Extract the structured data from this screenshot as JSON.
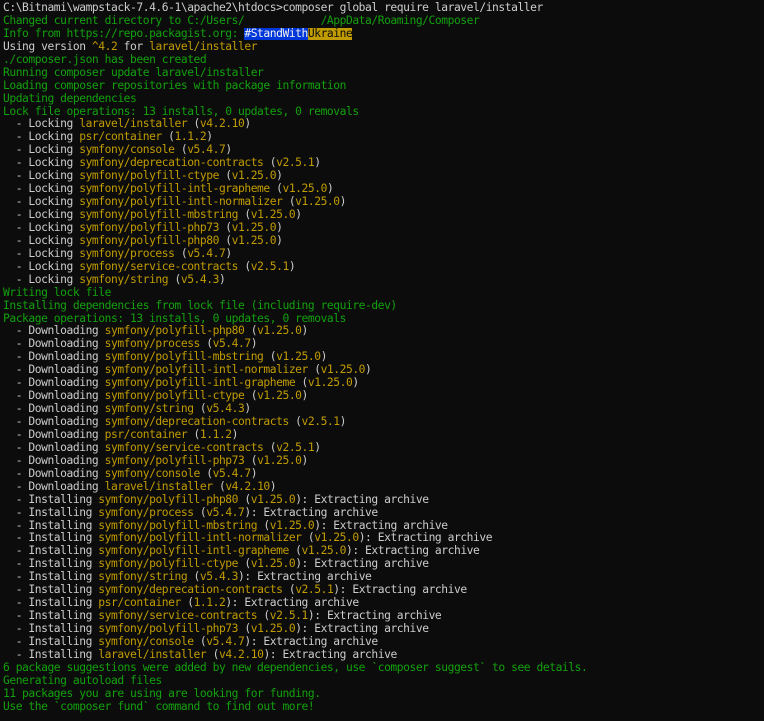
{
  "terminal": {
    "colors": {
      "background": "#0c0c0c",
      "white": "#cccccc",
      "green": "#13a10e",
      "yellow": "#c19c00",
      "highlight_blue": "#0037da",
      "highlight_yellow": "#c19c00"
    },
    "lines": [
      [
        {
          "t": "C:\\Bitnami\\wampstack-7.4.6-1\\apache2\\htdocs>composer global require laravel/installer",
          "c": "white"
        }
      ],
      [
        {
          "t": "Changed current directory to C:/Users/            /AppData/Roaming/Composer",
          "c": "green"
        }
      ],
      [
        {
          "t": "Info from https://repo.packagist.org: ",
          "c": "green"
        },
        {
          "t": "#StandWith",
          "c": "hl-blue"
        },
        {
          "t": "Ukraine",
          "c": "hl-yellow"
        }
      ],
      [
        {
          "t": "Using version ",
          "c": "white"
        },
        {
          "t": "^4.2",
          "c": "yellow"
        },
        {
          "t": " for ",
          "c": "white"
        },
        {
          "t": "laravel/installer",
          "c": "yellow"
        }
      ],
      [
        {
          "t": "./composer.json has been created",
          "c": "green"
        }
      ],
      [
        {
          "t": "Running composer update laravel/installer",
          "c": "green"
        }
      ],
      [
        {
          "t": "Loading composer repositories with package information",
          "c": "green"
        }
      ],
      [
        {
          "t": "Updating dependencies",
          "c": "green"
        }
      ],
      [
        {
          "t": "Lock file operations: 13 installs, 0 updates, 0 removals",
          "c": "green"
        }
      ],
      [
        {
          "t": "  - Locking ",
          "c": "white"
        },
        {
          "t": "laravel/installer",
          "c": "yellow"
        },
        {
          "t": " (",
          "c": "white"
        },
        {
          "t": "v4.2.10",
          "c": "yellow"
        },
        {
          "t": ")",
          "c": "white"
        }
      ],
      [
        {
          "t": "  - Locking ",
          "c": "white"
        },
        {
          "t": "psr/container",
          "c": "yellow"
        },
        {
          "t": " (",
          "c": "white"
        },
        {
          "t": "1.1.2",
          "c": "yellow"
        },
        {
          "t": ")",
          "c": "white"
        }
      ],
      [
        {
          "t": "  - Locking ",
          "c": "white"
        },
        {
          "t": "symfony/console",
          "c": "yellow"
        },
        {
          "t": " (",
          "c": "white"
        },
        {
          "t": "v5.4.7",
          "c": "yellow"
        },
        {
          "t": ")",
          "c": "white"
        }
      ],
      [
        {
          "t": "  - Locking ",
          "c": "white"
        },
        {
          "t": "symfony/deprecation-contracts",
          "c": "yellow"
        },
        {
          "t": " (",
          "c": "white"
        },
        {
          "t": "v2.5.1",
          "c": "yellow"
        },
        {
          "t": ")",
          "c": "white"
        }
      ],
      [
        {
          "t": "  - Locking ",
          "c": "white"
        },
        {
          "t": "symfony/polyfill-ctype",
          "c": "yellow"
        },
        {
          "t": " (",
          "c": "white"
        },
        {
          "t": "v1.25.0",
          "c": "yellow"
        },
        {
          "t": ")",
          "c": "white"
        }
      ],
      [
        {
          "t": "  - Locking ",
          "c": "white"
        },
        {
          "t": "symfony/polyfill-intl-grapheme",
          "c": "yellow"
        },
        {
          "t": " (",
          "c": "white"
        },
        {
          "t": "v1.25.0",
          "c": "yellow"
        },
        {
          "t": ")",
          "c": "white"
        }
      ],
      [
        {
          "t": "  - Locking ",
          "c": "white"
        },
        {
          "t": "symfony/polyfill-intl-normalizer",
          "c": "yellow"
        },
        {
          "t": " (",
          "c": "white"
        },
        {
          "t": "v1.25.0",
          "c": "yellow"
        },
        {
          "t": ")",
          "c": "white"
        }
      ],
      [
        {
          "t": "  - Locking ",
          "c": "white"
        },
        {
          "t": "symfony/polyfill-mbstring",
          "c": "yellow"
        },
        {
          "t": " (",
          "c": "white"
        },
        {
          "t": "v1.25.0",
          "c": "yellow"
        },
        {
          "t": ")",
          "c": "white"
        }
      ],
      [
        {
          "t": "  - Locking ",
          "c": "white"
        },
        {
          "t": "symfony/polyfill-php73",
          "c": "yellow"
        },
        {
          "t": " (",
          "c": "white"
        },
        {
          "t": "v1.25.0",
          "c": "yellow"
        },
        {
          "t": ")",
          "c": "white"
        }
      ],
      [
        {
          "t": "  - Locking ",
          "c": "white"
        },
        {
          "t": "symfony/polyfill-php80",
          "c": "yellow"
        },
        {
          "t": " (",
          "c": "white"
        },
        {
          "t": "v1.25.0",
          "c": "yellow"
        },
        {
          "t": ")",
          "c": "white"
        }
      ],
      [
        {
          "t": "  - Locking ",
          "c": "white"
        },
        {
          "t": "symfony/process",
          "c": "yellow"
        },
        {
          "t": " (",
          "c": "white"
        },
        {
          "t": "v5.4.7",
          "c": "yellow"
        },
        {
          "t": ")",
          "c": "white"
        }
      ],
      [
        {
          "t": "  - Locking ",
          "c": "white"
        },
        {
          "t": "symfony/service-contracts",
          "c": "yellow"
        },
        {
          "t": " (",
          "c": "white"
        },
        {
          "t": "v2.5.1",
          "c": "yellow"
        },
        {
          "t": ")",
          "c": "white"
        }
      ],
      [
        {
          "t": "  - Locking ",
          "c": "white"
        },
        {
          "t": "symfony/string",
          "c": "yellow"
        },
        {
          "t": " (",
          "c": "white"
        },
        {
          "t": "v5.4.3",
          "c": "yellow"
        },
        {
          "t": ")",
          "c": "white"
        }
      ],
      [
        {
          "t": "Writing lock file",
          "c": "green"
        }
      ],
      [
        {
          "t": "Installing dependencies from lock file (including require-dev)",
          "c": "green"
        }
      ],
      [
        {
          "t": "Package operations: 13 installs, 0 updates, 0 removals",
          "c": "green"
        }
      ],
      [
        {
          "t": "  - Downloading ",
          "c": "white"
        },
        {
          "t": "symfony/polyfill-php80",
          "c": "yellow"
        },
        {
          "t": " (",
          "c": "white"
        },
        {
          "t": "v1.25.0",
          "c": "yellow"
        },
        {
          "t": ")",
          "c": "white"
        }
      ],
      [
        {
          "t": "  - Downloading ",
          "c": "white"
        },
        {
          "t": "symfony/process",
          "c": "yellow"
        },
        {
          "t": " (",
          "c": "white"
        },
        {
          "t": "v5.4.7",
          "c": "yellow"
        },
        {
          "t": ")",
          "c": "white"
        }
      ],
      [
        {
          "t": "  - Downloading ",
          "c": "white"
        },
        {
          "t": "symfony/polyfill-mbstring",
          "c": "yellow"
        },
        {
          "t": " (",
          "c": "white"
        },
        {
          "t": "v1.25.0",
          "c": "yellow"
        },
        {
          "t": ")",
          "c": "white"
        }
      ],
      [
        {
          "t": "  - Downloading ",
          "c": "white"
        },
        {
          "t": "symfony/polyfill-intl-normalizer",
          "c": "yellow"
        },
        {
          "t": " (",
          "c": "white"
        },
        {
          "t": "v1.25.0",
          "c": "yellow"
        },
        {
          "t": ")",
          "c": "white"
        }
      ],
      [
        {
          "t": "  - Downloading ",
          "c": "white"
        },
        {
          "t": "symfony/polyfill-intl-grapheme",
          "c": "yellow"
        },
        {
          "t": " (",
          "c": "white"
        },
        {
          "t": "v1.25.0",
          "c": "yellow"
        },
        {
          "t": ")",
          "c": "white"
        }
      ],
      [
        {
          "t": "  - Downloading ",
          "c": "white"
        },
        {
          "t": "symfony/polyfill-ctype",
          "c": "yellow"
        },
        {
          "t": " (",
          "c": "white"
        },
        {
          "t": "v1.25.0",
          "c": "yellow"
        },
        {
          "t": ")",
          "c": "white"
        }
      ],
      [
        {
          "t": "  - Downloading ",
          "c": "white"
        },
        {
          "t": "symfony/string",
          "c": "yellow"
        },
        {
          "t": " (",
          "c": "white"
        },
        {
          "t": "v5.4.3",
          "c": "yellow"
        },
        {
          "t": ")",
          "c": "white"
        }
      ],
      [
        {
          "t": "  - Downloading ",
          "c": "white"
        },
        {
          "t": "symfony/deprecation-contracts",
          "c": "yellow"
        },
        {
          "t": " (",
          "c": "white"
        },
        {
          "t": "v2.5.1",
          "c": "yellow"
        },
        {
          "t": ")",
          "c": "white"
        }
      ],
      [
        {
          "t": "  - Downloading ",
          "c": "white"
        },
        {
          "t": "psr/container",
          "c": "yellow"
        },
        {
          "t": " (",
          "c": "white"
        },
        {
          "t": "1.1.2",
          "c": "yellow"
        },
        {
          "t": ")",
          "c": "white"
        }
      ],
      [
        {
          "t": "  - Downloading ",
          "c": "white"
        },
        {
          "t": "symfony/service-contracts",
          "c": "yellow"
        },
        {
          "t": " (",
          "c": "white"
        },
        {
          "t": "v2.5.1",
          "c": "yellow"
        },
        {
          "t": ")",
          "c": "white"
        }
      ],
      [
        {
          "t": "  - Downloading ",
          "c": "white"
        },
        {
          "t": "symfony/polyfill-php73",
          "c": "yellow"
        },
        {
          "t": " (",
          "c": "white"
        },
        {
          "t": "v1.25.0",
          "c": "yellow"
        },
        {
          "t": ")",
          "c": "white"
        }
      ],
      [
        {
          "t": "  - Downloading ",
          "c": "white"
        },
        {
          "t": "symfony/console",
          "c": "yellow"
        },
        {
          "t": " (",
          "c": "white"
        },
        {
          "t": "v5.4.7",
          "c": "yellow"
        },
        {
          "t": ")",
          "c": "white"
        }
      ],
      [
        {
          "t": "  - Downloading ",
          "c": "white"
        },
        {
          "t": "laravel/installer",
          "c": "yellow"
        },
        {
          "t": " (",
          "c": "white"
        },
        {
          "t": "v4.2.10",
          "c": "yellow"
        },
        {
          "t": ")",
          "c": "white"
        }
      ],
      [
        {
          "t": "  - Installing ",
          "c": "white"
        },
        {
          "t": "symfony/polyfill-php80",
          "c": "yellow"
        },
        {
          "t": " (",
          "c": "white"
        },
        {
          "t": "v1.25.0",
          "c": "yellow"
        },
        {
          "t": "): Extracting archive",
          "c": "white"
        }
      ],
      [
        {
          "t": "  - Installing ",
          "c": "white"
        },
        {
          "t": "symfony/process",
          "c": "yellow"
        },
        {
          "t": " (",
          "c": "white"
        },
        {
          "t": "v5.4.7",
          "c": "yellow"
        },
        {
          "t": "): Extracting archive",
          "c": "white"
        }
      ],
      [
        {
          "t": "  - Installing ",
          "c": "white"
        },
        {
          "t": "symfony/polyfill-mbstring",
          "c": "yellow"
        },
        {
          "t": " (",
          "c": "white"
        },
        {
          "t": "v1.25.0",
          "c": "yellow"
        },
        {
          "t": "): Extracting archive",
          "c": "white"
        }
      ],
      [
        {
          "t": "  - Installing ",
          "c": "white"
        },
        {
          "t": "symfony/polyfill-intl-normalizer",
          "c": "yellow"
        },
        {
          "t": " (",
          "c": "white"
        },
        {
          "t": "v1.25.0",
          "c": "yellow"
        },
        {
          "t": "): Extracting archive",
          "c": "white"
        }
      ],
      [
        {
          "t": "  - Installing ",
          "c": "white"
        },
        {
          "t": "symfony/polyfill-intl-grapheme",
          "c": "yellow"
        },
        {
          "t": " (",
          "c": "white"
        },
        {
          "t": "v1.25.0",
          "c": "yellow"
        },
        {
          "t": "): Extracting archive",
          "c": "white"
        }
      ],
      [
        {
          "t": "  - Installing ",
          "c": "white"
        },
        {
          "t": "symfony/polyfill-ctype",
          "c": "yellow"
        },
        {
          "t": " (",
          "c": "white"
        },
        {
          "t": "v1.25.0",
          "c": "yellow"
        },
        {
          "t": "): Extracting archive",
          "c": "white"
        }
      ],
      [
        {
          "t": "  - Installing ",
          "c": "white"
        },
        {
          "t": "symfony/string",
          "c": "yellow"
        },
        {
          "t": " (",
          "c": "white"
        },
        {
          "t": "v5.4.3",
          "c": "yellow"
        },
        {
          "t": "): Extracting archive",
          "c": "white"
        }
      ],
      [
        {
          "t": "  - Installing ",
          "c": "white"
        },
        {
          "t": "symfony/deprecation-contracts",
          "c": "yellow"
        },
        {
          "t": " (",
          "c": "white"
        },
        {
          "t": "v2.5.1",
          "c": "yellow"
        },
        {
          "t": "): Extracting archive",
          "c": "white"
        }
      ],
      [
        {
          "t": "  - Installing ",
          "c": "white"
        },
        {
          "t": "psr/container",
          "c": "yellow"
        },
        {
          "t": " (",
          "c": "white"
        },
        {
          "t": "1.1.2",
          "c": "yellow"
        },
        {
          "t": "): Extracting archive",
          "c": "white"
        }
      ],
      [
        {
          "t": "  - Installing ",
          "c": "white"
        },
        {
          "t": "symfony/service-contracts",
          "c": "yellow"
        },
        {
          "t": " (",
          "c": "white"
        },
        {
          "t": "v2.5.1",
          "c": "yellow"
        },
        {
          "t": "): Extracting archive",
          "c": "white"
        }
      ],
      [
        {
          "t": "  - Installing ",
          "c": "white"
        },
        {
          "t": "symfony/polyfill-php73",
          "c": "yellow"
        },
        {
          "t": " (",
          "c": "white"
        },
        {
          "t": "v1.25.0",
          "c": "yellow"
        },
        {
          "t": "): Extracting archive",
          "c": "white"
        }
      ],
      [
        {
          "t": "  - Installing ",
          "c": "white"
        },
        {
          "t": "symfony/console",
          "c": "yellow"
        },
        {
          "t": " (",
          "c": "white"
        },
        {
          "t": "v5.4.7",
          "c": "yellow"
        },
        {
          "t": "): Extracting archive",
          "c": "white"
        }
      ],
      [
        {
          "t": "  - Installing ",
          "c": "white"
        },
        {
          "t": "laravel/installer",
          "c": "yellow"
        },
        {
          "t": " (",
          "c": "white"
        },
        {
          "t": "v4.2.10",
          "c": "yellow"
        },
        {
          "t": "): Extracting archive",
          "c": "white"
        }
      ],
      [
        {
          "t": "6 package suggestions were added by new dependencies, use `composer suggest` to see details.",
          "c": "green"
        }
      ],
      [
        {
          "t": "Generating autoload files",
          "c": "green"
        }
      ],
      [
        {
          "t": "11 packages you are using are looking for funding.",
          "c": "green"
        }
      ],
      [
        {
          "t": "Use the `composer fund` command to find out more!",
          "c": "green"
        }
      ]
    ]
  }
}
